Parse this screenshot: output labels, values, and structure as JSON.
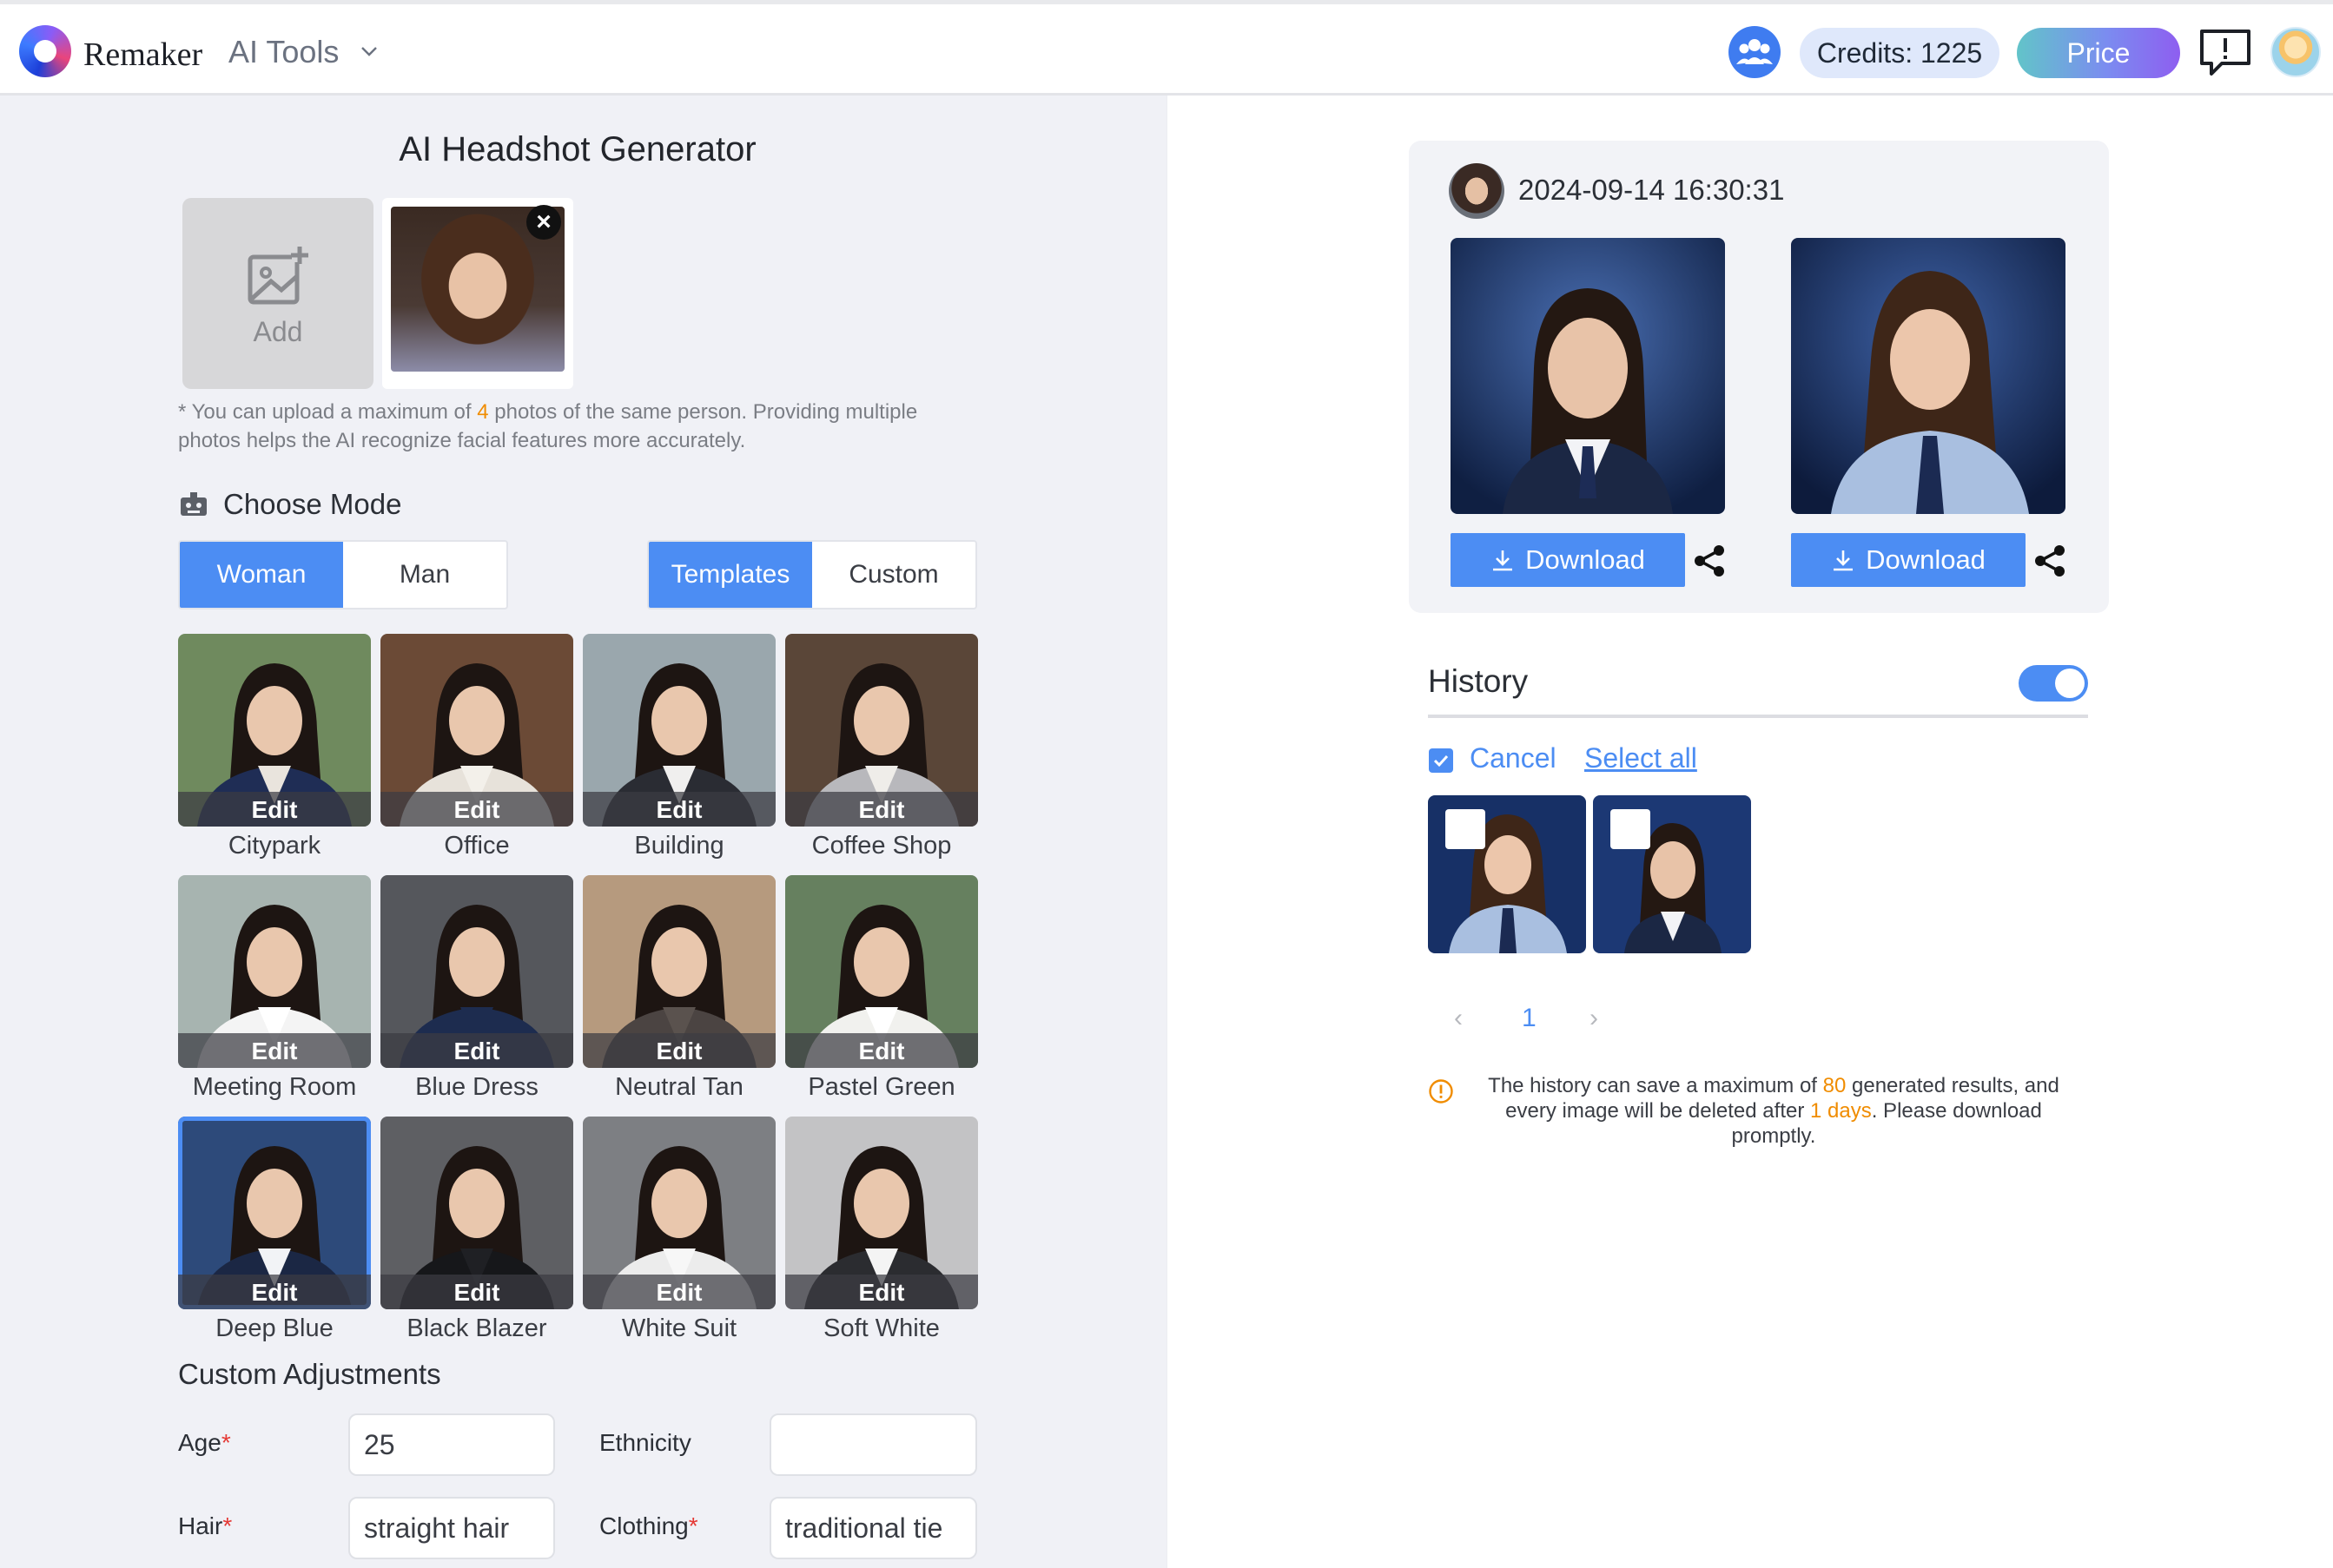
{
  "header": {
    "brand": "Remaker",
    "menu": "AI Tools",
    "credits": "Credits: 1225",
    "price": "Price"
  },
  "generator": {
    "title": "AI Headshot Generator",
    "add_label": "Add",
    "note_before": "* You can upload a maximum of ",
    "note_count": "4",
    "note_after": " photos of the same person. Providing multiple photos helps the AI recognize facial features more accurately.",
    "choose_mode": "Choose Mode",
    "gender_options": [
      "Woman",
      "Man"
    ],
    "type_options": [
      "Templates",
      "Custom"
    ],
    "edit_label": "Edit",
    "templates": [
      {
        "name": "Citypark",
        "bg": "#6f8a5e",
        "suit": "#1f2d55",
        "shirt": "#e9e4dd"
      },
      {
        "name": "Office",
        "bg": "#6b4a36",
        "suit": "#e7e2da",
        "shirt": "#f3f0ea"
      },
      {
        "name": "Building",
        "bg": "#9aa7ad",
        "suit": "#2a2c33",
        "shirt": "#f0efee"
      },
      {
        "name": "Coffee Shop",
        "bg": "#5a4638",
        "suit": "#b8b8bc",
        "shirt": "#efede9"
      },
      {
        "name": "Meeting Room",
        "bg": "#a7b4b0",
        "suit": "#f4f4f4",
        "shirt": "#ffffff"
      },
      {
        "name": "Blue Dress",
        "bg": "#55575c",
        "suit": "#1d2c4f",
        "shirt": "#1d2c4f"
      },
      {
        "name": "Neutral Tan",
        "bg": "#b69a7e",
        "suit": "#4b4442",
        "shirt": "#5a524e"
      },
      {
        "name": "Pastel Green",
        "bg": "#66805f",
        "suit": "#f1f1ee",
        "shirt": "#ffffff"
      },
      {
        "name": "Deep Blue",
        "bg": "#2d4a7a",
        "suit": "#1b2744",
        "shirt": "#f2f3f6"
      },
      {
        "name": "Black Blazer",
        "bg": "#5e5f63",
        "suit": "#16171a",
        "shirt": "#1f2024"
      },
      {
        "name": "White Suit",
        "bg": "#7d7f83",
        "suit": "#ececec",
        "shirt": "#f7f7f7"
      },
      {
        "name": "Soft White",
        "bg": "#c3c3c5",
        "suit": "#2b2c30",
        "shirt": "#f4f4f4"
      }
    ],
    "selected_template": "Deep Blue",
    "adjustments_title": "Custom Adjustments",
    "fields": {
      "age_label": "Age",
      "age_value": "25",
      "ethnicity_label": "Ethnicity",
      "ethnicity_value": "",
      "hair_label": "Hair",
      "hair_value": "straight hair",
      "clothing_label": "Clothing",
      "clothing_value": "traditional tie"
    }
  },
  "result": {
    "timestamp": "2024-09-14 16:30:31",
    "download_label": "Download"
  },
  "history": {
    "title": "History",
    "cancel": "Cancel",
    "select_all": "Select all",
    "page_current": "1",
    "prev": "‹",
    "next": "›",
    "warn_a": "The history can save a maximum of ",
    "warn_count": "80",
    "warn_b": " generated results, and every image will be deleted after ",
    "warn_days": "1 days",
    "warn_c": ". Please download promptly."
  },
  "colors": {
    "accent": "#4c8df3",
    "highlight": "#f08c00",
    "required": "#e53935"
  }
}
